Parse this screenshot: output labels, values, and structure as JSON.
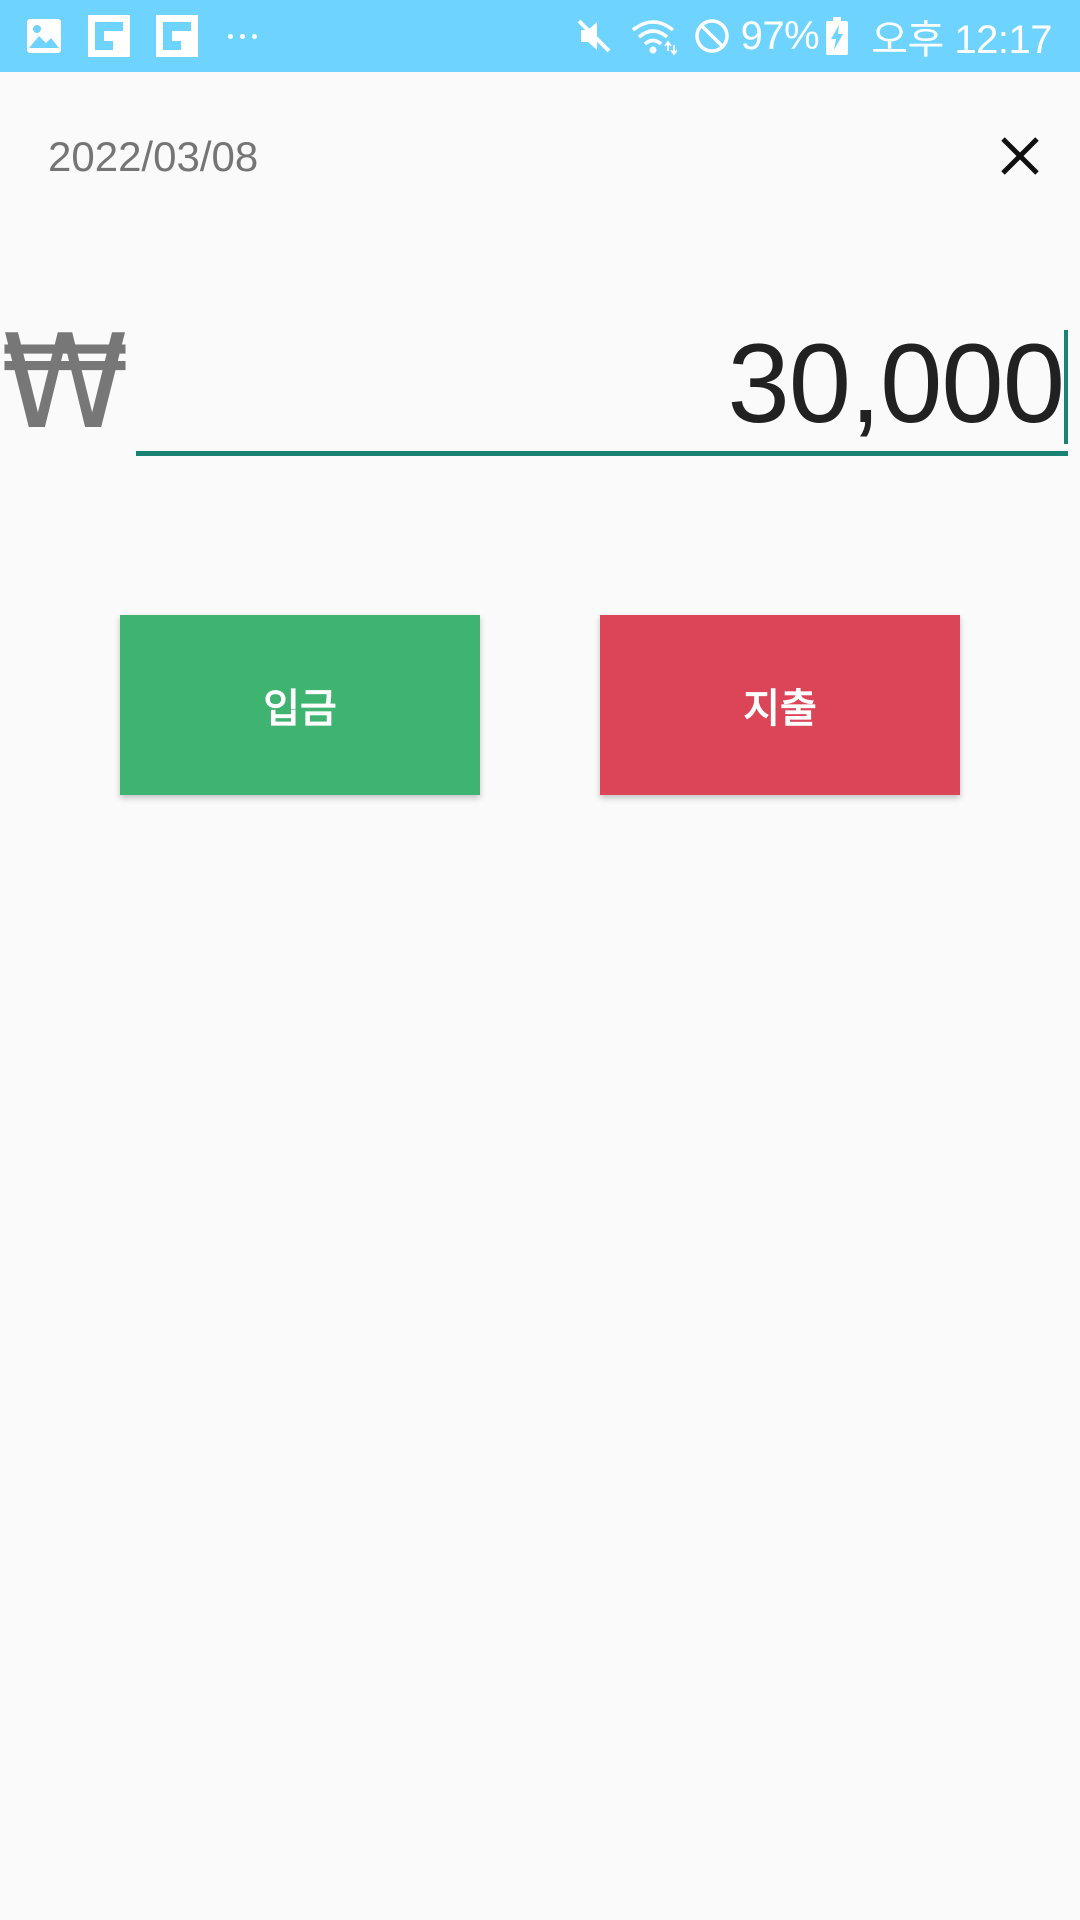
{
  "status_bar": {
    "left_icons": [
      "gallery-icon",
      "flipboard-icon",
      "flipboard-icon",
      "more-notifications-icon"
    ],
    "right_icons": [
      "mute-icon",
      "wifi-icon",
      "do-not-disturb-icon",
      "battery-charging-icon"
    ],
    "battery": "97%",
    "time": "오후 12:17"
  },
  "header": {
    "date": "2022/03/08",
    "close_icon": "close-icon"
  },
  "amount": {
    "currency": "₩",
    "value": "30,000"
  },
  "buttons": {
    "income_label": "입금",
    "expense_label": "지출"
  },
  "colors": {
    "status_bar": "#6fd3ff",
    "underline": "#1a8273",
    "income": "#3fb470",
    "expense": "#db4557",
    "background": "#fafafa"
  }
}
